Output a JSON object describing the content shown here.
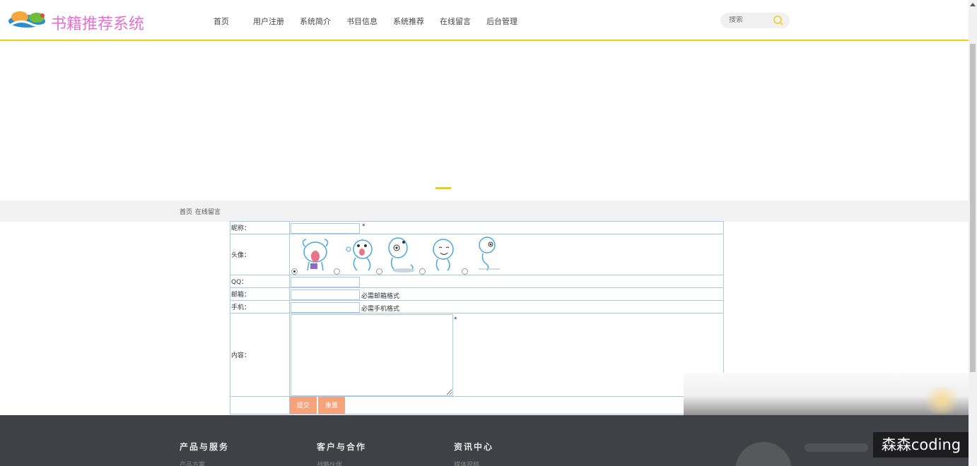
{
  "brand": {
    "title": "书籍推荐系统",
    "accent": "#f2cb17",
    "title_color": "#e66fd2"
  },
  "nav": {
    "items": [
      "首页",
      "用户注册",
      "系统简介",
      "书目信息",
      "系统推荐",
      "在线留言",
      "后台管理"
    ]
  },
  "search": {
    "placeholder": "搜索"
  },
  "breadcrumb": {
    "home": "首页",
    "current": "在线留言"
  },
  "form": {
    "nickname_label": "昵称：",
    "nickname_required": "*",
    "avatar_label": "头像：",
    "avatar_selected_index": 0,
    "avatar_count": 5,
    "qq_label": "QQ：",
    "email_label": "邮箱：",
    "email_hint": "必需邮箱格式",
    "phone_label": "手机：",
    "phone_hint": "必需手机格式",
    "content_label": "内容：",
    "content_required": "*",
    "submit_label": "提交",
    "reset_label": "重置"
  },
  "footer": {
    "columns": [
      {
        "title": "产品与服务",
        "sub": "产品方案"
      },
      {
        "title": "客户与合作",
        "sub": "战略伙伴"
      },
      {
        "title": "资讯中心",
        "sub": "媒体视频"
      }
    ]
  },
  "watermark": "森森coding"
}
